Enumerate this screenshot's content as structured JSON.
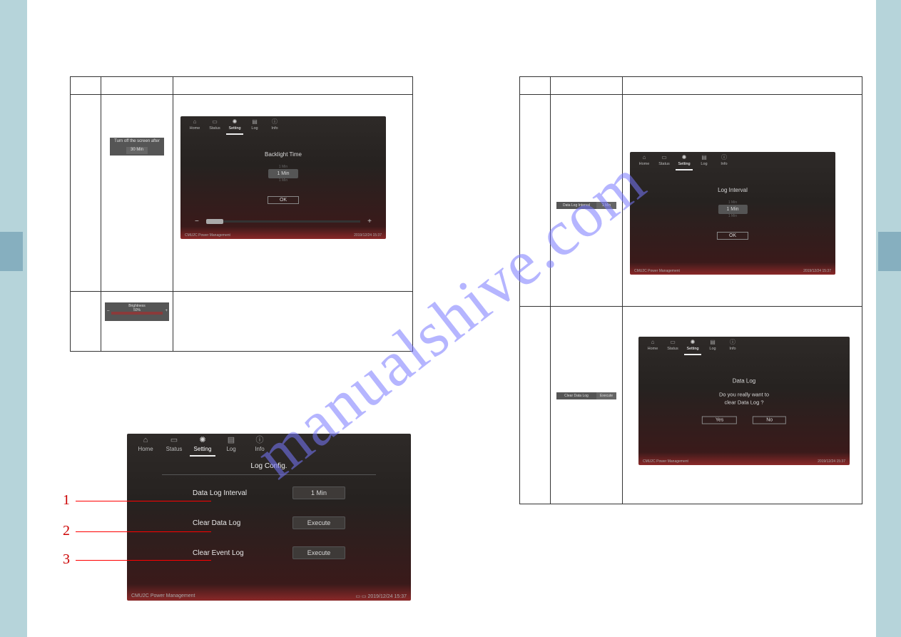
{
  "nav": {
    "home": "Home",
    "status": "Status",
    "setting": "Setting",
    "log": "Log",
    "info": "Info"
  },
  "footer": {
    "product": "CMU2C Power Management",
    "datetime": "2019/12/24 15:37"
  },
  "left_table": {
    "row1": {
      "thumb_label": "Turn off the screen after",
      "thumb_value": "30 Min",
      "dialog_title": "Backlight Time",
      "dialog_value": "1 Min",
      "dialog_ghost": "1 Min",
      "ok": "OK"
    },
    "row2": {
      "thumb_top": "Brightness",
      "thumb_value": "50%"
    }
  },
  "right_table": {
    "row1": {
      "thumb_label": "Data Log Interval",
      "thumb_value": "1 Min",
      "dialog_title": "Log Interval",
      "dialog_value": "1 Min",
      "dialog_ghost": "1 Min",
      "ok": "OK"
    },
    "row2": {
      "thumb_label": "Clear Data Log",
      "thumb_value": "Execute",
      "dialog_title": "Data Log",
      "dialog_msg1": "Do you really want to",
      "dialog_msg2": "clear Data Log ?",
      "yes": "Yes",
      "no": "No"
    }
  },
  "log_config": {
    "title": "Log Config.",
    "r1_label": "Data Log Interval",
    "r1_value": "1 Min",
    "r2_label": "Clear Data Log",
    "r2_value": "Execute",
    "r3_label": "Clear Event Log",
    "r3_value": "Execute"
  },
  "callouts": {
    "one": "1",
    "two": "2",
    "three": "3"
  },
  "watermark": "manualshive.com"
}
